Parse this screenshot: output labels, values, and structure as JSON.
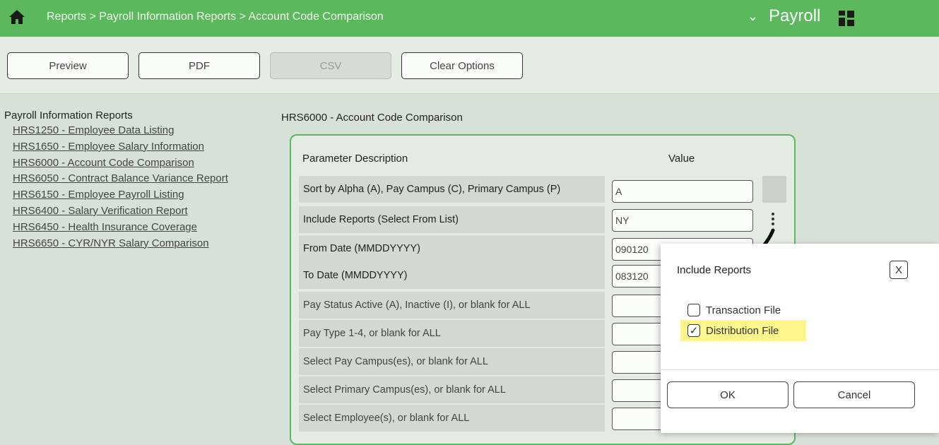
{
  "header": {
    "breadcrumb": "Reports > Payroll Information Reports > Account Code Comparison",
    "module": "Payroll",
    "icons": [
      "home-icon",
      "chevron-down-icon",
      "grid-icon"
    ],
    "color": "#5cb85c"
  },
  "toolbar": {
    "preview": "Preview",
    "pdf": "PDF",
    "csv": "CSV",
    "clear": "Clear Options"
  },
  "sidebar": {
    "title": "Payroll Information Reports",
    "items": [
      "HRS1250 - Employee Data Listing",
      "HRS1650 - Employee Salary Information",
      "HRS6000 - Account Code Comparison",
      "HRS6050 - Contract Balance Variance Report",
      "HRS6150 - Employee Payroll Listing",
      "HRS6400 - Salary Verification Report",
      "HRS6450 - Health Insurance Coverage",
      "HRS6650 - CYR/NYR Salary Comparison"
    ]
  },
  "main": {
    "title": "HRS6000 - Account Code Comparison",
    "col_param": "Parameter Description",
    "col_value": "Value",
    "params": [
      {
        "label": "Sort by Alpha (A), Pay Campus (C), Primary Campus (P)",
        "value": "A"
      },
      {
        "label": "Include Reports (Select From List)",
        "value": "NY"
      },
      {
        "label": "From Date (MMDDYYYY)",
        "value": "090120"
      },
      {
        "label": "To Date (MMDDYYYY)",
        "value": "083120"
      },
      {
        "label": "Pay Status Active (A), Inactive (I), or blank for ALL",
        "value": ""
      },
      {
        "label": "Pay Type 1-4, or blank for ALL",
        "value": ""
      },
      {
        "label": "Select Pay Campus(es), or blank for ALL",
        "value": ""
      },
      {
        "label": "Select Primary Campus(es), or blank for ALL",
        "value": ""
      },
      {
        "label": "Select Employee(s), or blank for ALL",
        "value": ""
      }
    ]
  },
  "dialog": {
    "title": "Include Reports",
    "close": "X",
    "options": [
      {
        "label": "Transaction File",
        "checked": false,
        "mark": ""
      },
      {
        "label": "Distribution File",
        "checked": true,
        "mark": "✓"
      }
    ],
    "ok": "OK",
    "cancel": "Cancel",
    "highlight_color": "#fcf58c"
  }
}
